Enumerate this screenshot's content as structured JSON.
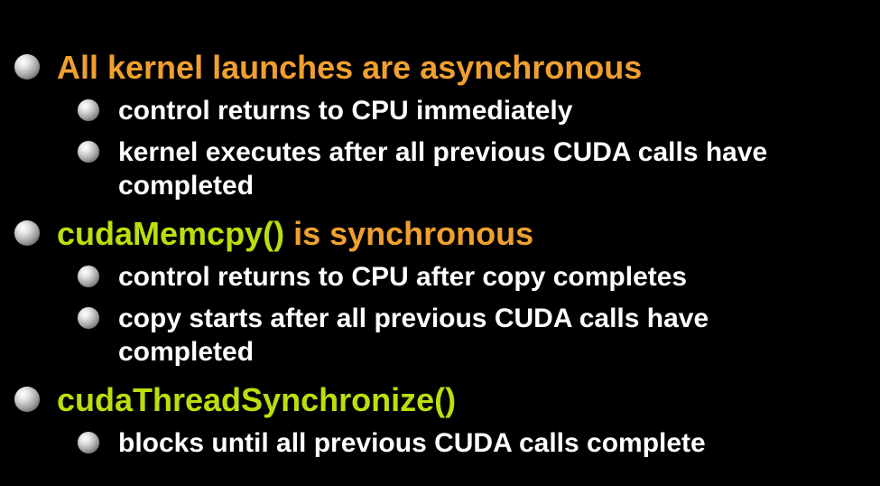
{
  "colors": {
    "background": "#000000",
    "heading_orange": "#f0a030",
    "code_green": "#bedd0c",
    "subtext": "#ffffff"
  },
  "bullets": [
    {
      "heading": "All kernel launches are asynchronous",
      "subitems": [
        "control returns to CPU immediately",
        "kernel executes after all previous CUDA calls have completed"
      ]
    },
    {
      "heading_code": "cudaMemcpy()",
      "heading_rest": " is synchronous",
      "subitems": [
        "control returns to CPU after copy completes",
        "copy starts after all previous CUDA calls have completed"
      ]
    },
    {
      "heading_code": "cudaThreadSynchronize()",
      "subitems": [
        "blocks until all previous CUDA calls complete"
      ]
    }
  ]
}
